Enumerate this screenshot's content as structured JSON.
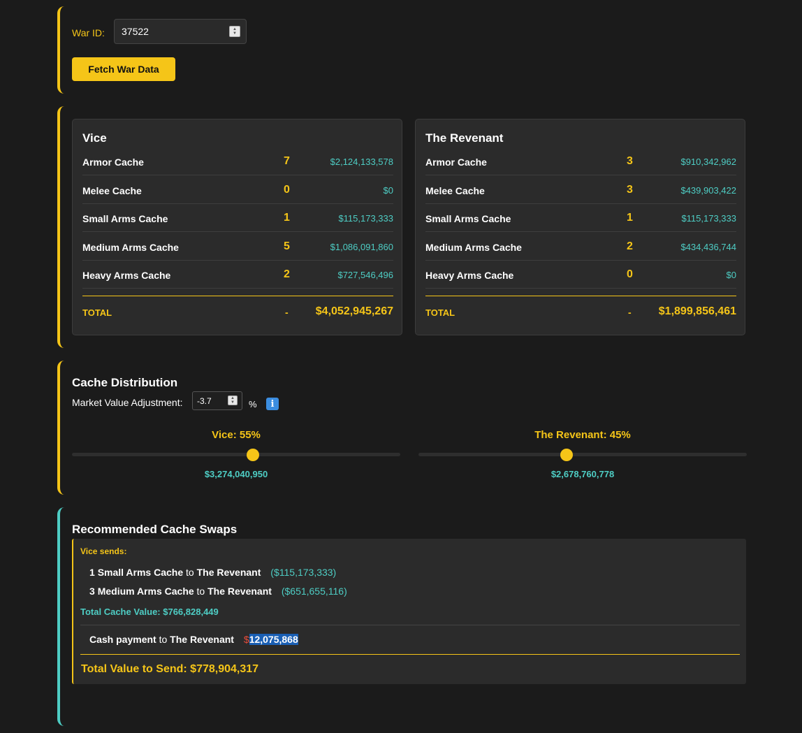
{
  "war": {
    "id_label": "War ID:",
    "id_value": "37522",
    "fetch_button": "Fetch War Data"
  },
  "factions": [
    {
      "name": "Vice",
      "rows": [
        {
          "name": "Armor Cache",
          "qty": "7",
          "value": "$2,124,133,578"
        },
        {
          "name": "Melee Cache",
          "qty": "0",
          "value": "$0"
        },
        {
          "name": "Small Arms Cache",
          "qty": "1",
          "value": "$115,173,333"
        },
        {
          "name": "Medium Arms Cache",
          "qty": "5",
          "value": "$1,086,091,860"
        },
        {
          "name": "Heavy Arms Cache",
          "qty": "2",
          "value": "$727,546,496"
        }
      ],
      "total_label": "TOTAL",
      "total_qty": "-",
      "total_value": "$4,052,945,267"
    },
    {
      "name": "The Revenant",
      "rows": [
        {
          "name": "Armor Cache",
          "qty": "3",
          "value": "$910,342,962"
        },
        {
          "name": "Melee Cache",
          "qty": "3",
          "value": "$439,903,422"
        },
        {
          "name": "Small Arms Cache",
          "qty": "1",
          "value": "$115,173,333"
        },
        {
          "name": "Medium Arms Cache",
          "qty": "2",
          "value": "$434,436,744"
        },
        {
          "name": "Heavy Arms Cache",
          "qty": "0",
          "value": "$0"
        }
      ],
      "total_label": "TOTAL",
      "total_qty": "-",
      "total_value": "$1,899,856,461"
    }
  ],
  "distribution": {
    "title": "Cache Distribution",
    "adjustment_label": "Market Value Adjustment:",
    "adjustment_value": "-3.7",
    "percent_sign": "%",
    "info_glyph": "i",
    "sliders": [
      {
        "label": "Vice: 55%",
        "percent": 55,
        "value": "$3,274,040,950"
      },
      {
        "label": "The Revenant: 45%",
        "percent": 45,
        "value": "$2,678,760,778"
      }
    ]
  },
  "swaps": {
    "title": "Recommended Cache Swaps",
    "sends_label": "Vice sends:",
    "items": [
      {
        "qty": "1",
        "cache": "Small Arms Cache",
        "to_word": "to",
        "recipient": "The Revenant",
        "amount": "($115,173,333)"
      },
      {
        "qty": "3",
        "cache": "Medium Arms Cache",
        "to_word": "to",
        "recipient": "The Revenant",
        "amount": "($651,655,116)"
      }
    ],
    "total_cache_value": "Total Cache Value: $766,828,449",
    "cash": {
      "label": "Cash payment",
      "to_word": "to",
      "recipient": "The Revenant",
      "dollar": "$",
      "amount": "12,075,868"
    },
    "total_to_send": "Total Value to Send: $778,904,317"
  },
  "colors": {
    "gold": "#f5c518",
    "teal": "#4ecdc4",
    "background": "#1b1b1b",
    "card": "#2b2b2b"
  }
}
